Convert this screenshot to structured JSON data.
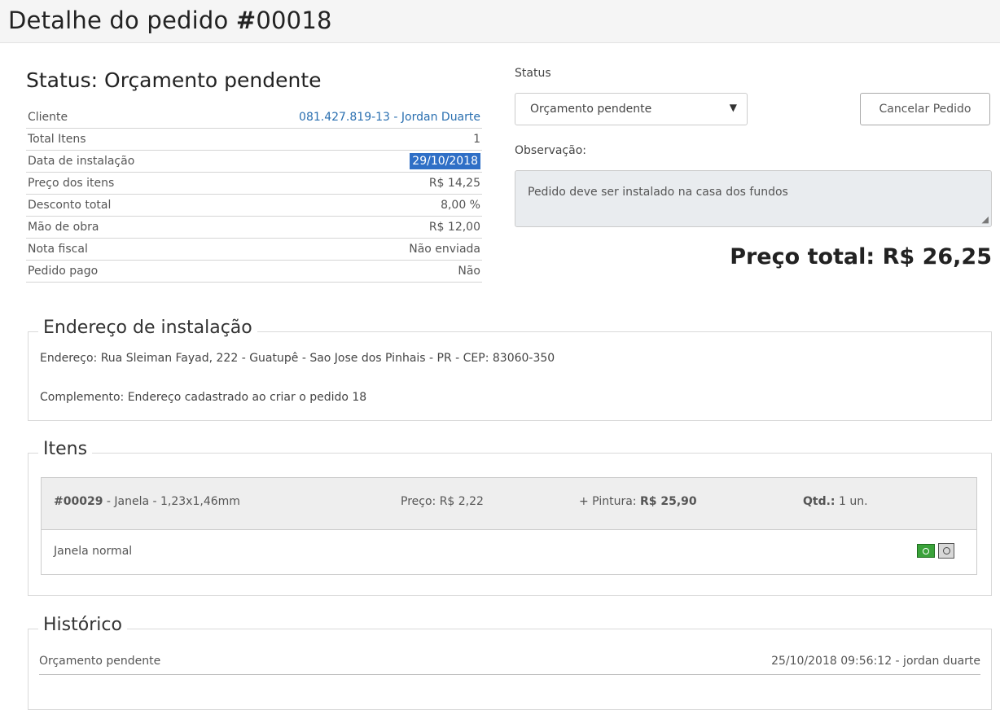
{
  "header": {
    "title_prefix": "Detalhe do pedido ",
    "hash_symbol": "#",
    "order_number": "00018"
  },
  "status_heading": "Status: Orçamento pendente",
  "info": {
    "cliente_label": "Cliente",
    "cliente_value": "081.427.819-13 - Jordan Duarte",
    "total_itens_label": "Total Itens",
    "total_itens_value": "1",
    "data_label": "Data de instalação",
    "data_value": "29/10/2018",
    "preco_label": "Preço dos itens",
    "preco_value": "R$ 14,25",
    "desconto_label": "Desconto total",
    "desconto_value": "8,00 %",
    "mao_label": "Mão de obra",
    "mao_value": "R$ 12,00",
    "nota_label": "Nota fiscal",
    "nota_value": "Não enviada",
    "pago_label": "Pedido pago",
    "pago_value": "Não"
  },
  "status_form": {
    "label": "Status",
    "selected": "Orçamento pendente",
    "cancel_label": "Cancelar Pedido",
    "obs_label": "Observação:",
    "obs_text": "Pedido deve ser instalado na casa dos fundos"
  },
  "total_price": "Preço total: R$ 26,25",
  "address": {
    "legend": "Endereço de instalação",
    "line": "Endereço: Rua Sleiman Fayad, 222 - Guatupê - Sao Jose dos Pinhais - PR - CEP: 83060-350",
    "complement": "Complemento: Endereço cadastrado ao criar o pedido 18"
  },
  "items": {
    "legend": "Itens",
    "list": [
      {
        "code": "#00029",
        "desc": " - Janela - 1,23x1,46mm",
        "price": "Preço: R$ 2,22",
        "paint_label": "+ Pintura: ",
        "paint_value": "R$ 25,90",
        "qty_label": "Qtd.:",
        "qty_value": " 1 un.",
        "name": "Janela normal"
      }
    ]
  },
  "history": {
    "legend": "Histórico",
    "entries": [
      {
        "status": "Orçamento pendente",
        "when": "25/10/2018 09:56:12 - jordan duarte"
      }
    ]
  }
}
